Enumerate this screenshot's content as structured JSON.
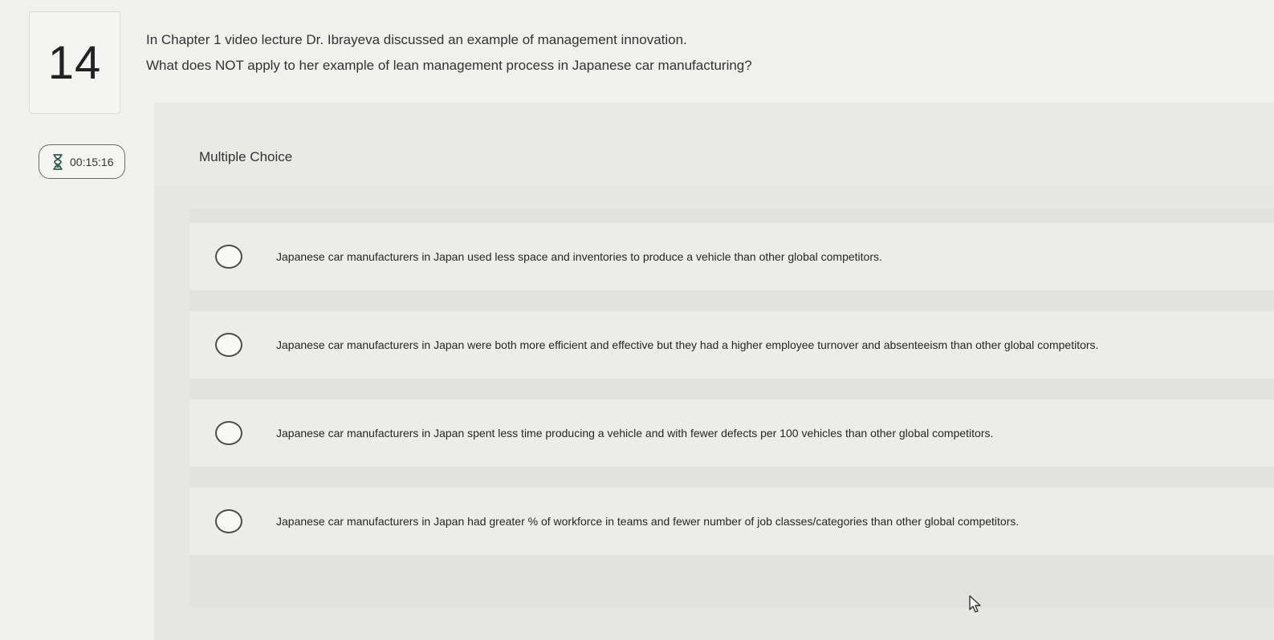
{
  "question": {
    "number": "14",
    "lines": [
      "In Chapter 1 video lecture Dr. Ibrayeva discussed an example of management innovation.",
      "What does NOT apply to her example of lean management process in Japanese car manufacturing?"
    ]
  },
  "timer": {
    "icon": "hourglass-icon",
    "value": "00:15:16"
  },
  "question_type": "Multiple Choice",
  "options": [
    {
      "label": "Japanese car manufacturers in Japan used less space and inventories to produce a vehicle than other global competitors."
    },
    {
      "label": "Japanese car manufacturers in Japan  were both more efficient and effective but they had a higher employee turnover and absenteeism than other global competitors."
    },
    {
      "label": "Japanese car manufacturers in Japan spent less time producing a vehicle and with fewer defects per 100 vehicles than other global competitors."
    },
    {
      "label": "Japanese car manufacturers in Japan had greater % of workforce in teams and fewer number of job classes/categories than other global competitors."
    }
  ],
  "colors": {
    "background": "#f0f0ee",
    "panel": "#e6e6e4",
    "text": "#2b2b2b",
    "radio_border": "#4d4d4d"
  }
}
